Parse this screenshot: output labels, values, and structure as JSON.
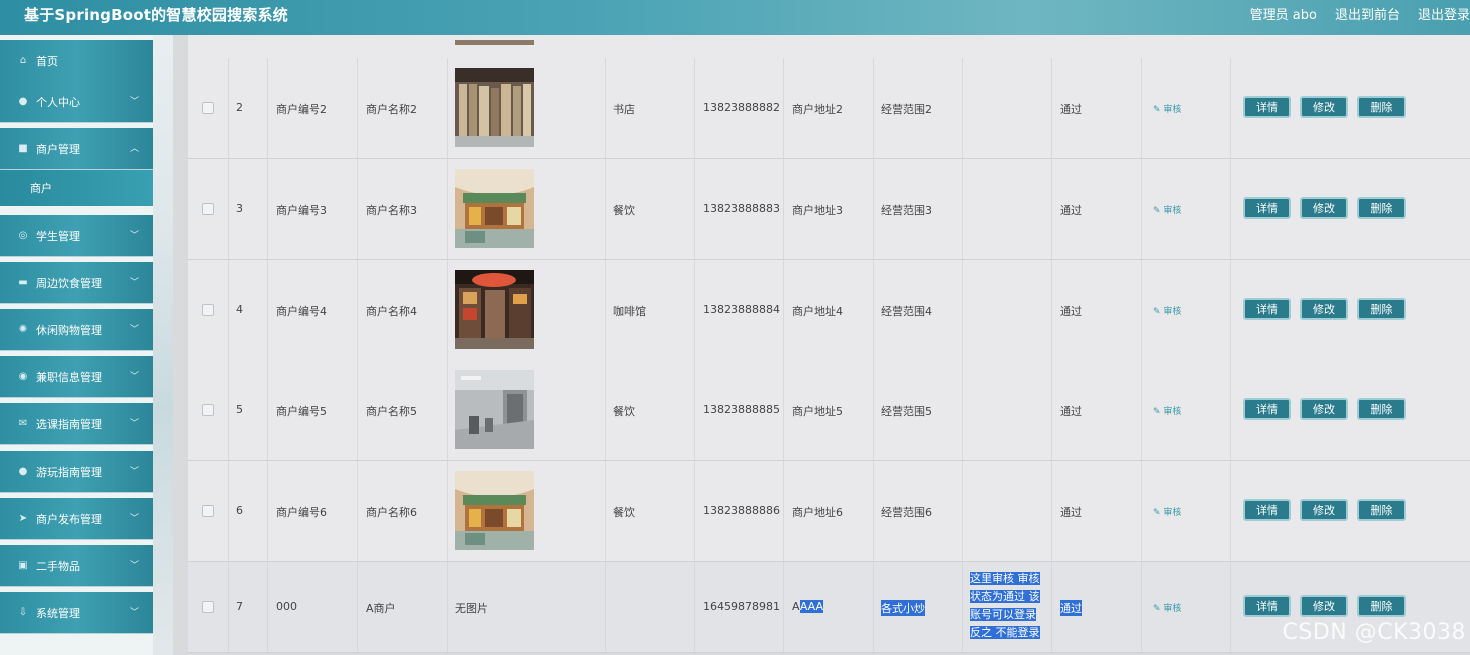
{
  "header": {
    "title": "基于SpringBoot的智慧校园搜索系统",
    "admin": "管理员 abo",
    "to_front": "退出到前台",
    "logout": "退出登录"
  },
  "sidebar": {
    "items": [
      {
        "label": "首页",
        "icon": "home-icon"
      },
      {
        "label": "个人中心",
        "icon": "user-icon",
        "chevron": "down"
      },
      {
        "label": "商户管理",
        "icon": "merchant-icon",
        "chevron": "up"
      },
      {
        "label": "学生管理",
        "icon": "student-icon",
        "chevron": "down"
      },
      {
        "label": "周边饮食管理",
        "icon": "food-icon",
        "chevron": "down"
      },
      {
        "label": "休闲购物管理",
        "icon": "shopping-icon",
        "chevron": "down"
      },
      {
        "label": "兼职信息管理",
        "icon": "job-icon",
        "chevron": "down"
      },
      {
        "label": "选课指南管理",
        "icon": "course-icon",
        "chevron": "down"
      },
      {
        "label": "游玩指南管理",
        "icon": "travel-icon",
        "chevron": "down"
      },
      {
        "label": "商户发布管理",
        "icon": "publish-icon",
        "chevron": "down"
      },
      {
        "label": "二手物品",
        "icon": "secondhand-icon",
        "chevron": "down"
      },
      {
        "label": "系统管理",
        "icon": "system-icon",
        "chevron": "down"
      }
    ],
    "submenu": "商户"
  },
  "table": {
    "rows": [
      {
        "no": "2",
        "code": "商户编号2",
        "name": "商户名称2",
        "image": "bookstore",
        "type": "书店",
        "phone": "13823888882",
        "address": "商户地址2",
        "scope": "经营范围2",
        "reply": "",
        "status": "通过"
      },
      {
        "no": "3",
        "code": "商户编号3",
        "name": "商户名称3",
        "image": "restaurant",
        "type": "餐饮",
        "phone": "13823888883",
        "address": "商户地址3",
        "scope": "经营范围3",
        "reply": "",
        "status": "通过"
      },
      {
        "no": "4",
        "code": "商户编号4",
        "name": "商户名称4",
        "image": "cafe",
        "type": "咖啡馆",
        "phone": "13823888884",
        "address": "商户地址4",
        "scope": "经营范围4",
        "reply": "",
        "status": "通过"
      },
      {
        "no": "5",
        "code": "商户编号5",
        "name": "商户名称5",
        "image": "hall",
        "type": "餐饮",
        "phone": "13823888885",
        "address": "商户地址5",
        "scope": "经营范围5",
        "reply": "",
        "status": "通过"
      },
      {
        "no": "6",
        "code": "商户编号6",
        "name": "商户名称6",
        "image": "restaurant",
        "type": "餐饮",
        "phone": "13823888886",
        "address": "商户地址6",
        "scope": "经营范围6",
        "reply": "",
        "status": "通过"
      },
      {
        "no": "7",
        "code": "000",
        "name": "A商户",
        "image_text": "无图片",
        "type": "",
        "phone": "16459878981",
        "address_prefix": "A",
        "address_hl": "AAA",
        "scope": "各式小炒",
        "reply_lines": [
          "这里审核 审核",
          "状态为通过 该",
          "账号可以登录",
          "反之 不能登录"
        ],
        "status": "通过"
      }
    ],
    "audit_label": "审核",
    "btn_detail": "详情",
    "btn_edit": "修改",
    "btn_delete": "删除"
  },
  "watermark": "CSDN @CK3038"
}
